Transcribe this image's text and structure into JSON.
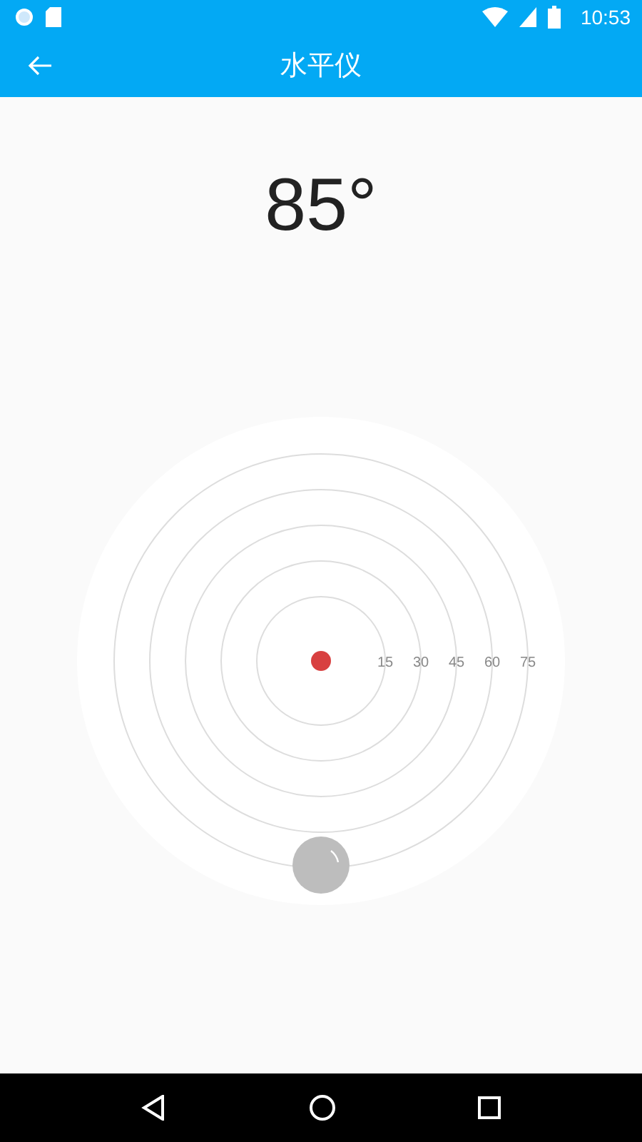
{
  "status_bar": {
    "time": "10:53"
  },
  "app_bar": {
    "title": "水平仪"
  },
  "reading": "85°",
  "dial": {
    "ring_labels": [
      "15",
      "30",
      "45",
      "60",
      "75"
    ]
  }
}
